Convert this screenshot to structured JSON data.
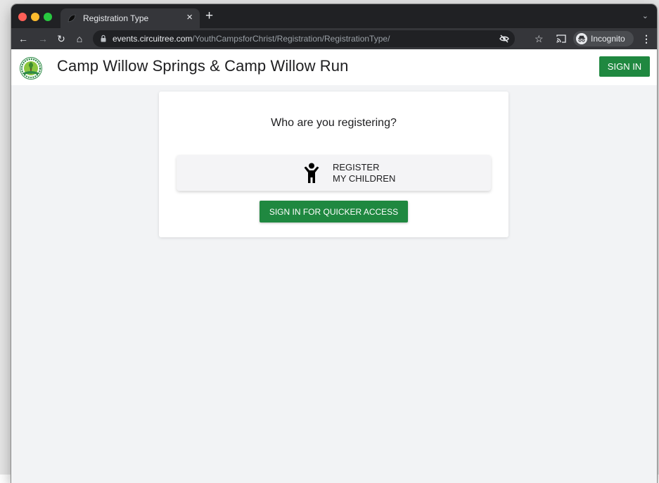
{
  "browser": {
    "tab_title": "Registration Type",
    "tab_close": "×",
    "new_tab": "+",
    "tab_search": "⌄",
    "url_host": "events.circuitree.com",
    "url_path": "/YouthCampsforChrist/Registration/RegistrationType/",
    "profile_label": "Incognito",
    "menu": "⋮",
    "back": "←",
    "forward": "→",
    "reload": "↻",
    "home": "⌂",
    "star": "☆",
    "icons": [
      "back-icon",
      "forward-icon",
      "reload-icon",
      "home-icon",
      "lock-icon",
      "eye-off-icon",
      "star-icon",
      "cast-icon",
      "incognito-icon",
      "menu-icon"
    ]
  },
  "header": {
    "title": "Camp Willow Springs & Camp Willow Run",
    "sign_in_label": "SIGN IN"
  },
  "card": {
    "question": "Who are you registering?",
    "option_line1": "REGISTER",
    "option_line2": "MY CHILDREN",
    "quick_access_label": "SIGN IN FOR QUICKER ACCESS"
  },
  "colors": {
    "brand_green": "#1f8840",
    "page_bg": "#f2f3f5",
    "chrome_dark": "#202124",
    "chrome_toolbar": "#35363a"
  }
}
